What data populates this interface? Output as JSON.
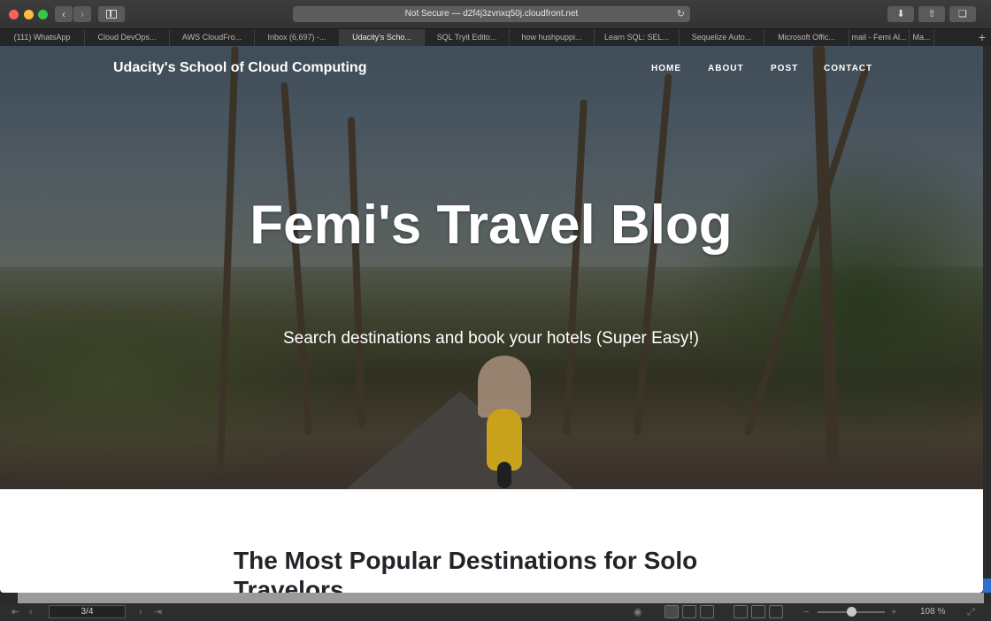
{
  "browser": {
    "url": "Not Secure — d2f4j3zvnxq50j.cloudfront.net",
    "tabs": [
      {
        "label": "(111) WhatsApp"
      },
      {
        "label": "Cloud DevOps..."
      },
      {
        "label": "AWS CloudFro..."
      },
      {
        "label": "Inbox (6,697) -..."
      },
      {
        "label": "Udacity's Scho..."
      },
      {
        "label": "SQL Tryit Edito..."
      },
      {
        "label": "how hushpuppi..."
      },
      {
        "label": "Learn SQL: SEL..."
      },
      {
        "label": "Sequelize Auto..."
      },
      {
        "label": "Microsoft Offic..."
      },
      {
        "label": "mail - Femi Al..."
      },
      {
        "label": "Ma..."
      }
    ],
    "active_tab_index": 4
  },
  "site": {
    "brand": "Udacity's School of Cloud Computing",
    "nav": {
      "home": "HOME",
      "about": "ABOUT",
      "post": "POST",
      "contact": "CONTACT"
    },
    "hero": {
      "title": "Femi's Travel Blog",
      "subtitle": "Search destinations and book your hotels (Super Easy!)"
    },
    "section_title": "The Most Popular Destinations for Solo Travelors"
  },
  "viewer": {
    "page_indicator": "3/4",
    "zoom": "108 %",
    "zoom_fraction": 0.5
  },
  "icons": {
    "back": "chevron-left-icon",
    "forward": "chevron-right-icon",
    "sidebar": "sidebar-icon",
    "reload": "reload-icon",
    "download": "download-icon",
    "share": "share-icon",
    "tabs": "tabs-overview-icon"
  }
}
